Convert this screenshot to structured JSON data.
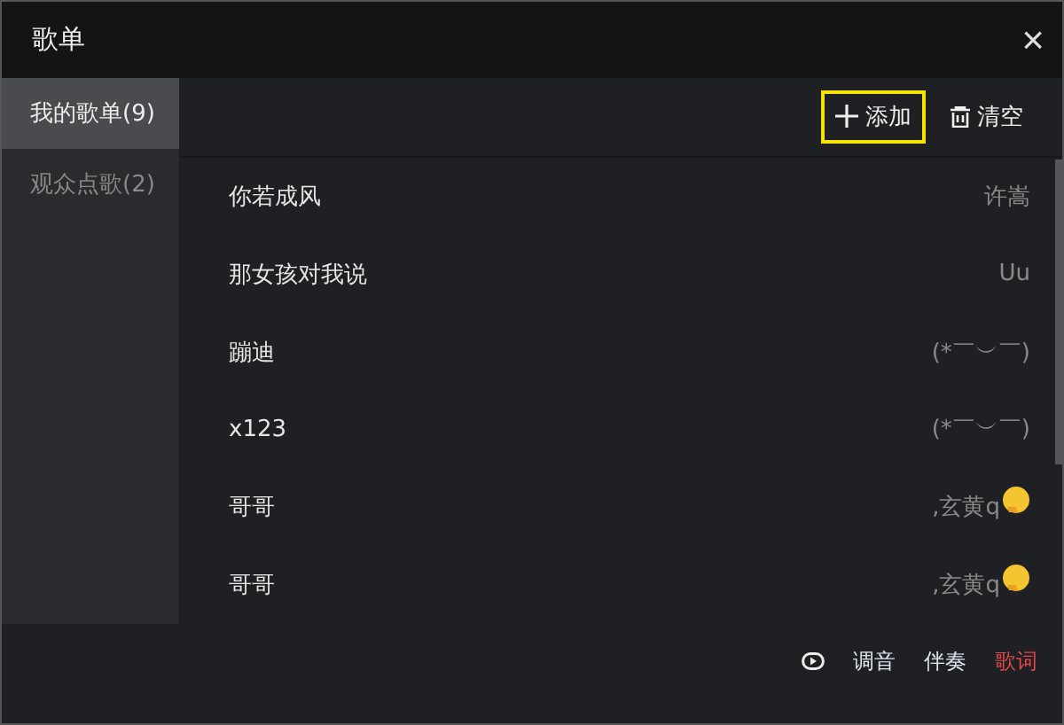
{
  "window": {
    "title": "歌单",
    "close": "×"
  },
  "sidebar": {
    "items": [
      {
        "label": "我的歌单(9)",
        "selected": true
      },
      {
        "label": "观众点歌(2)",
        "selected": false
      }
    ]
  },
  "toolbar": {
    "buttons": [
      {
        "kind": "add",
        "label": "添加",
        "highlighted": true
      },
      {
        "kind": "clear",
        "label": "清空",
        "highlighted": false
      }
    ]
  },
  "songs": [
    {
      "title": "你若成风",
      "artist": "许嵩",
      "emoji": false
    },
    {
      "title": "那女孩对我说",
      "artist": "Uu",
      "emoji": false
    },
    {
      "title": "蹦迪",
      "artist": "(*￣︶￣)",
      "emoji": false
    },
    {
      "title": "x123",
      "artist": "(*￣︶￣)",
      "emoji": false
    },
    {
      "title": "哥哥",
      "artist": ",玄黄q",
      "emoji": true
    },
    {
      "title": "哥哥",
      "artist": ",玄黄q",
      "emoji": true
    }
  ],
  "footer": {
    "tabs": [
      {
        "label": "调音",
        "selected": false
      },
      {
        "label": "伴奏",
        "selected": false
      },
      {
        "label": "歌词",
        "selected": true
      }
    ]
  }
}
